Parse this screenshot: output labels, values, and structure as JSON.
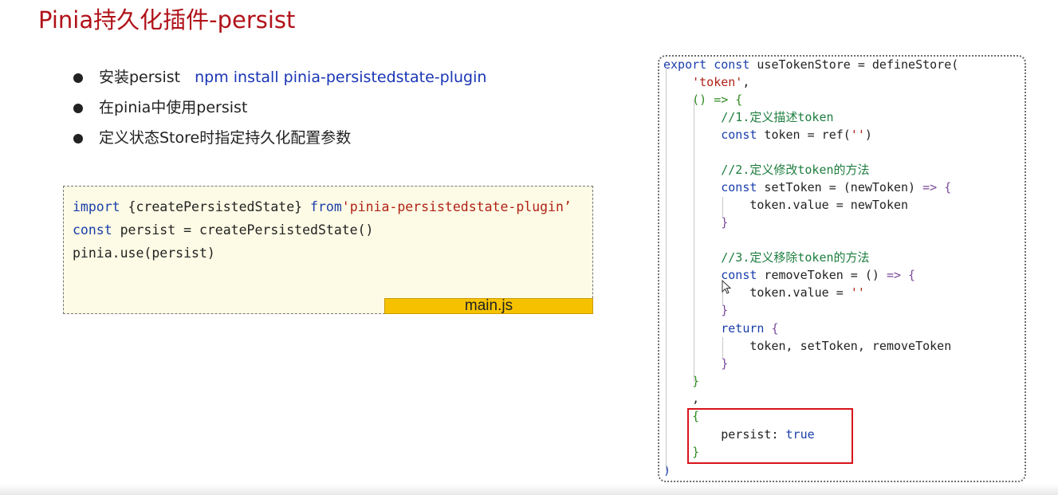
{
  "slide": {
    "title": "Pinia持久化插件-persist",
    "bullets": [
      {
        "text": "安装persist",
        "command": "npm install pinia-persistedstate-plugin"
      },
      {
        "text": "在pinia中使用persist"
      },
      {
        "text": "定义状态Store时指定持久化配置参数"
      }
    ]
  },
  "main_js": {
    "tab_label": "main.js",
    "lines": [
      [
        {
          "t": "import",
          "c": "kw"
        },
        {
          "t": " {createPersistedState} ",
          "c": ""
        },
        {
          "t": "from",
          "c": "kw"
        },
        {
          "t": "'pinia-persistedstate-plugin’",
          "c": "str"
        }
      ],
      [
        {
          "t": "const",
          "c": "kw"
        },
        {
          "t": " persist = createPersistedState()",
          "c": ""
        }
      ],
      [
        {
          "t": "pinia.use(persist)",
          "c": ""
        }
      ]
    ]
  },
  "store_code": {
    "lines": [
      [
        {
          "t": "export",
          "c": "kw"
        },
        {
          "t": " ",
          "c": ""
        },
        {
          "t": "const",
          "c": "kw"
        },
        {
          "t": " useTokenStore = defineStore(",
          "c": ""
        }
      ],
      [
        {
          "t": "    ",
          "c": ""
        },
        {
          "t": "'token'",
          "c": "str"
        },
        {
          "t": ",",
          "c": ""
        }
      ],
      [
        {
          "t": "    ",
          "c": ""
        },
        {
          "t": "() => {",
          "c": "brace"
        }
      ],
      [
        {
          "t": "        ",
          "c": ""
        },
        {
          "t": "//1.定义描述token",
          "c": "cmt"
        }
      ],
      [
        {
          "t": "        ",
          "c": ""
        },
        {
          "t": "const",
          "c": "kw"
        },
        {
          "t": " token = ref(",
          "c": ""
        },
        {
          "t": "''",
          "c": "str"
        },
        {
          "t": ")",
          "c": ""
        }
      ],
      [],
      [
        {
          "t": "        ",
          "c": ""
        },
        {
          "t": "//2.定义修改token的方法",
          "c": "cmt"
        }
      ],
      [
        {
          "t": "        ",
          "c": ""
        },
        {
          "t": "const",
          "c": "kw"
        },
        {
          "t": " setToken = (newToken) ",
          "c": ""
        },
        {
          "t": "=> {",
          "c": "brace2"
        }
      ],
      [
        {
          "t": "            token.value = newToken",
          "c": ""
        }
      ],
      [
        {
          "t": "        ",
          "c": ""
        },
        {
          "t": "}",
          "c": "brace2"
        }
      ],
      [],
      [
        {
          "t": "        ",
          "c": ""
        },
        {
          "t": "//3.定义移除token的方法",
          "c": "cmt"
        }
      ],
      [
        {
          "t": "        ",
          "c": ""
        },
        {
          "t": "const",
          "c": "kw"
        },
        {
          "t": " removeToken = () ",
          "c": ""
        },
        {
          "t": "=> {",
          "c": "brace2"
        }
      ],
      [
        {
          "t": "            token.value = ",
          "c": ""
        },
        {
          "t": "''",
          "c": "str"
        }
      ],
      [
        {
          "t": "        ",
          "c": ""
        },
        {
          "t": "}",
          "c": "brace2"
        }
      ],
      [
        {
          "t": "        ",
          "c": ""
        },
        {
          "t": "return",
          "c": "kw"
        },
        {
          "t": " {",
          "c": "brace2"
        }
      ],
      [
        {
          "t": "            token, setToken, removeToken",
          "c": ""
        }
      ],
      [
        {
          "t": "        ",
          "c": ""
        },
        {
          "t": "}",
          "c": "brace2"
        }
      ],
      [
        {
          "t": "    ",
          "c": ""
        },
        {
          "t": "}",
          "c": "brace"
        }
      ],
      [
        {
          "t": "    ,",
          "c": ""
        }
      ],
      [
        {
          "t": "    ",
          "c": ""
        },
        {
          "t": "{",
          "c": "brace"
        }
      ],
      [
        {
          "t": "        persist: ",
          "c": ""
        },
        {
          "t": "true",
          "c": "bool"
        }
      ],
      [
        {
          "t": "    ",
          "c": ""
        },
        {
          "t": "}",
          "c": "brace"
        }
      ],
      [
        {
          "t": ")",
          "c": "kw"
        }
      ]
    ]
  },
  "colors": {
    "title": "#b1121a",
    "keyword": "#1a3eab",
    "string": "#b02218",
    "comment": "#1e7e3f",
    "highlight_border": "#d8141c",
    "tab_background": "#f6c200",
    "code_background": "#fdfbe5"
  },
  "icons": [
    "mouse-cursor-icon"
  ]
}
